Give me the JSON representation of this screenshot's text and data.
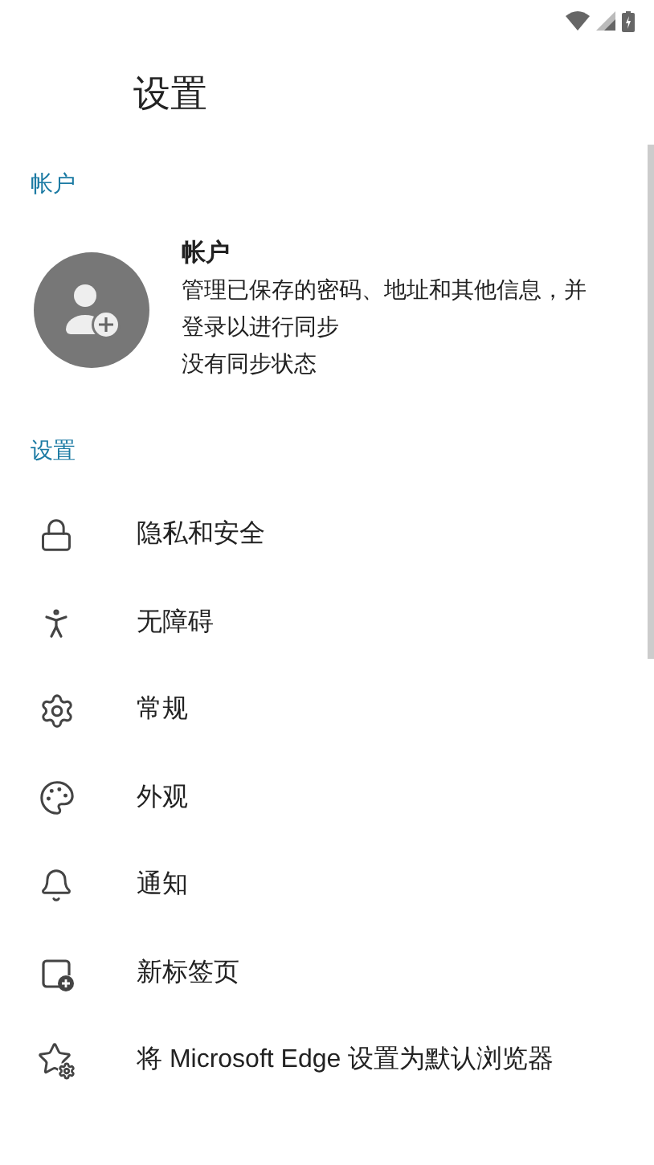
{
  "header": {
    "title": "设置"
  },
  "account_section": {
    "heading": "帐户",
    "title": "帐户",
    "description": "管理已保存的密码、地址和其他信息，并登录以进行同步",
    "sync_status": "没有同步状态"
  },
  "settings_section": {
    "heading": "设置",
    "items": [
      {
        "label": "隐私和安全"
      },
      {
        "label": "无障碍"
      },
      {
        "label": "常规"
      },
      {
        "label": "外观"
      },
      {
        "label": "通知"
      },
      {
        "label": "新标签页"
      },
      {
        "label": "将 Microsoft Edge 设置为默认浏览器"
      }
    ]
  }
}
